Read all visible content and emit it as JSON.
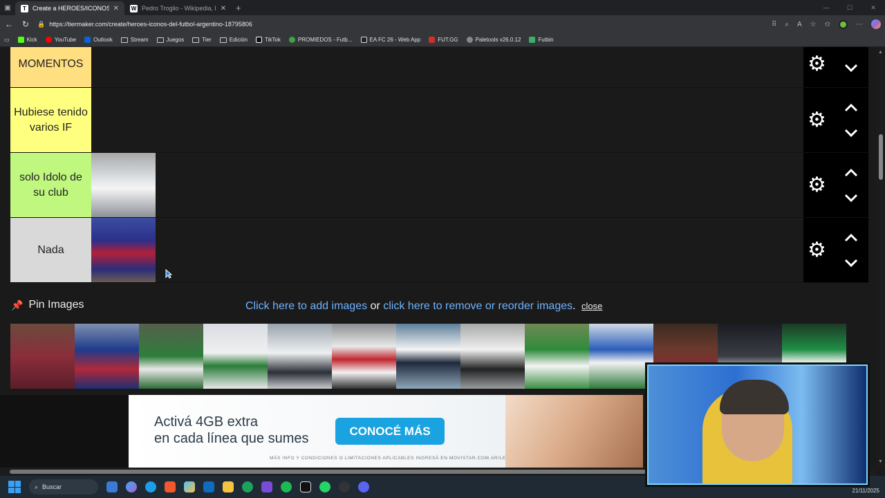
{
  "browser": {
    "tabs": [
      {
        "label": "Create a HEROES/ICONOS del FU",
        "active": true,
        "favicon": "tiermaker-icon"
      },
      {
        "label": "Pedro Troglio - Wikipedia, la enci",
        "active": false,
        "favicon": "wikipedia-icon"
      }
    ],
    "url": "https://tiermaker.com/create/heroes-iconos-del-futbol-argentino-18795806",
    "bookmarks": [
      {
        "label": "Kick",
        "color": "#53fc18"
      },
      {
        "label": "YouTube",
        "color": "#ff0000"
      },
      {
        "label": "Outlook",
        "color": "#0a64d6"
      },
      {
        "label": "Stream",
        "folder": true
      },
      {
        "label": "Juegos",
        "folder": true
      },
      {
        "label": "Tier",
        "folder": true
      },
      {
        "label": "Edición",
        "folder": true
      },
      {
        "label": "TikTok",
        "color": "#111111"
      },
      {
        "label": "PROMIEDOS - Futb...",
        "color": "#3fa33f"
      },
      {
        "label": "EA FC 26 - Web App",
        "color": "#222222"
      },
      {
        "label": "FUT.GG",
        "color": "#d0302b"
      },
      {
        "label": "Paletools v26.0.12",
        "color": "#888888"
      },
      {
        "label": "Futbin",
        "color": "#3bb06b"
      }
    ]
  },
  "tiers": [
    {
      "label": "MOMENTOS",
      "color": "#ffdf80"
    },
    {
      "label": "Hubiese tenido varios IF",
      "color": "#ffff7f"
    },
    {
      "label": "solo Idolo de su club",
      "color": "#bff77f"
    },
    {
      "label": "Nada",
      "color": "#d9d9d9"
    }
  ],
  "pin": {
    "header": "Pin Images",
    "link_add": "Click here to add images",
    "or": "or",
    "link_remove": "click here to remove or reorder images",
    "period": ".",
    "close": "close"
  },
  "ad": {
    "line1": "Activá 4GB extra",
    "line2": "en cada línea que sumes",
    "button": "CONOCÉ MÁS",
    "fine": "MÁS INFO Y CONDICIONES O LIMITACIONES APLICABLES INGRESÁ EN MOVISTAR.COM.AR/LEGALES"
  },
  "taskbar": {
    "search": "Buscar",
    "date": "21/11/2025"
  }
}
